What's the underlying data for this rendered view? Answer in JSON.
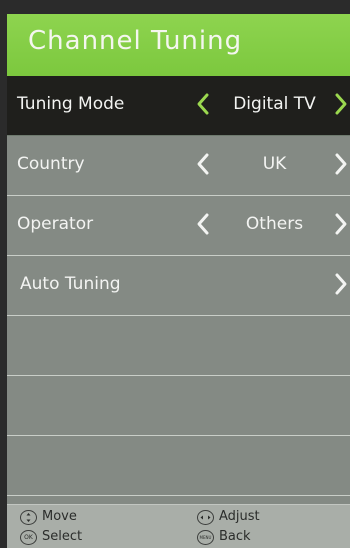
{
  "menu": {
    "title": "Channel Tuning"
  },
  "rows": [
    {
      "label": "Tuning Mode",
      "value": "Digital TV",
      "selected": true
    },
    {
      "label": "Country",
      "value": "UK",
      "selected": false
    },
    {
      "label": "Operator",
      "value": "Others",
      "selected": false
    },
    {
      "label": "Auto Tuning",
      "value": "",
      "selected": false
    }
  ],
  "hints": {
    "move": {
      "icon_text": "",
      "label": "Move"
    },
    "adjust": {
      "icon_text": "",
      "label": "Adjust"
    },
    "select": {
      "icon_text": "OK",
      "label": "Select"
    },
    "back": {
      "icon_text": "MENU",
      "label": "Back"
    }
  },
  "colors": {
    "header": "#8ed44f",
    "panel": "#848a84",
    "selected_row": "#1f1f1c",
    "accent_arrow": "#9bd84f",
    "footer": "#a9aea8"
  },
  "icons": {
    "left_arrow": "chevron-left-icon",
    "right_arrow": "chevron-right-icon",
    "move": "dpad-updown-icon",
    "adjust": "dpad-leftright-icon",
    "select": "ok-button-icon",
    "back": "menu-button-icon"
  }
}
